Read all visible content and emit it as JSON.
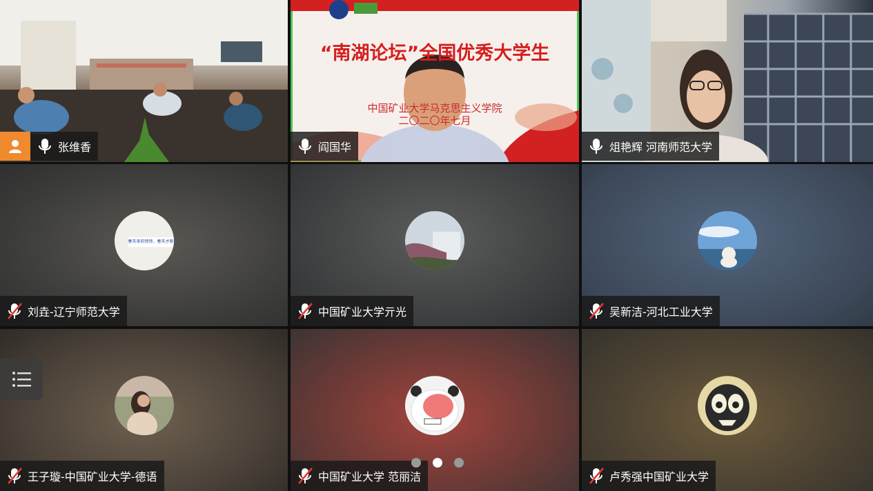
{
  "tiles": [
    {
      "name": "张维香",
      "mic": "on"
    },
    {
      "name": "阎国华",
      "mic": "on",
      "active": true
    },
    {
      "name": "俎艳辉 河南师范大学",
      "mic": "on"
    },
    {
      "name": "刘垚-辽宁师范大学",
      "mic": "muted"
    },
    {
      "name": "中国矿业大学亓光",
      "mic": "muted"
    },
    {
      "name": "吴新洁-河北工业大学",
      "mic": "muted"
    },
    {
      "name": "王子璇-中国矿业大学-德语",
      "mic": "muted"
    },
    {
      "name": "中国矿业大学 范丽洁",
      "mic": "muted"
    },
    {
      "name": "卢秀强中国矿业大学",
      "mic": "muted"
    }
  ],
  "banner": {
    "title": "“南湖论坛”全国优秀大学生",
    "subtitle": "中国矿业大学马克思主义学院",
    "date": "二〇二〇年七月"
  },
  "avatar_text": "春天来的惊惊，春天才刚到达",
  "pagination": {
    "pages": 3,
    "current": 2
  },
  "colors": {
    "active_border": "#4ec25a",
    "host_badge": "#f08a2e",
    "banner_red": "#d51f1f"
  }
}
